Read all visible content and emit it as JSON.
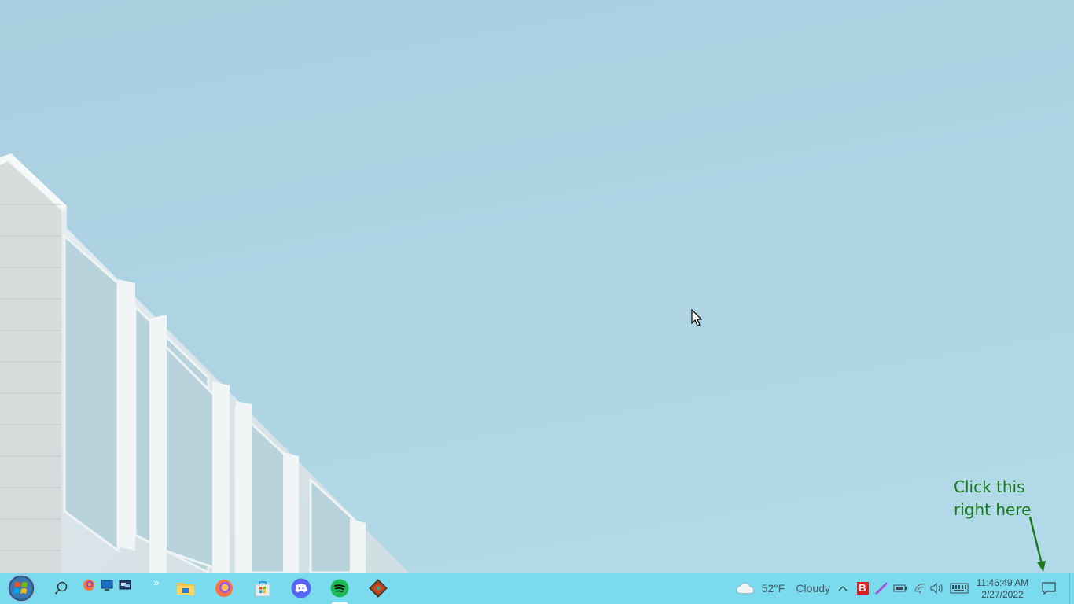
{
  "annotation": {
    "text": "Click this\nright here"
  },
  "taskbar": {
    "quick_launch_overflow": "»",
    "weather": {
      "temperature": "52°F",
      "condition": "Cloudy"
    },
    "tray_chevron": "^",
    "clock": {
      "time": "11:46:49 AM",
      "date": "2/27/2022"
    },
    "pdf_tray_label": "B"
  },
  "colors": {
    "taskbar": "#79dbed",
    "annotation": "#1a7a1a",
    "discord": "#5865f2",
    "spotify": "#1db954"
  },
  "icons": [
    "windows-start-orb-icon",
    "search-icon",
    "firefox-icon",
    "desktop-icon",
    "window-icon",
    "file-explorer-icon",
    "microsoft-store-icon",
    "discord-icon",
    "spotify-icon",
    "diamond-app-icon",
    "cloud-icon",
    "pdf-icon",
    "pen-icon",
    "battery-icon",
    "wifi-icon",
    "volume-icon",
    "keyboard-icon",
    "notification-icon"
  ]
}
